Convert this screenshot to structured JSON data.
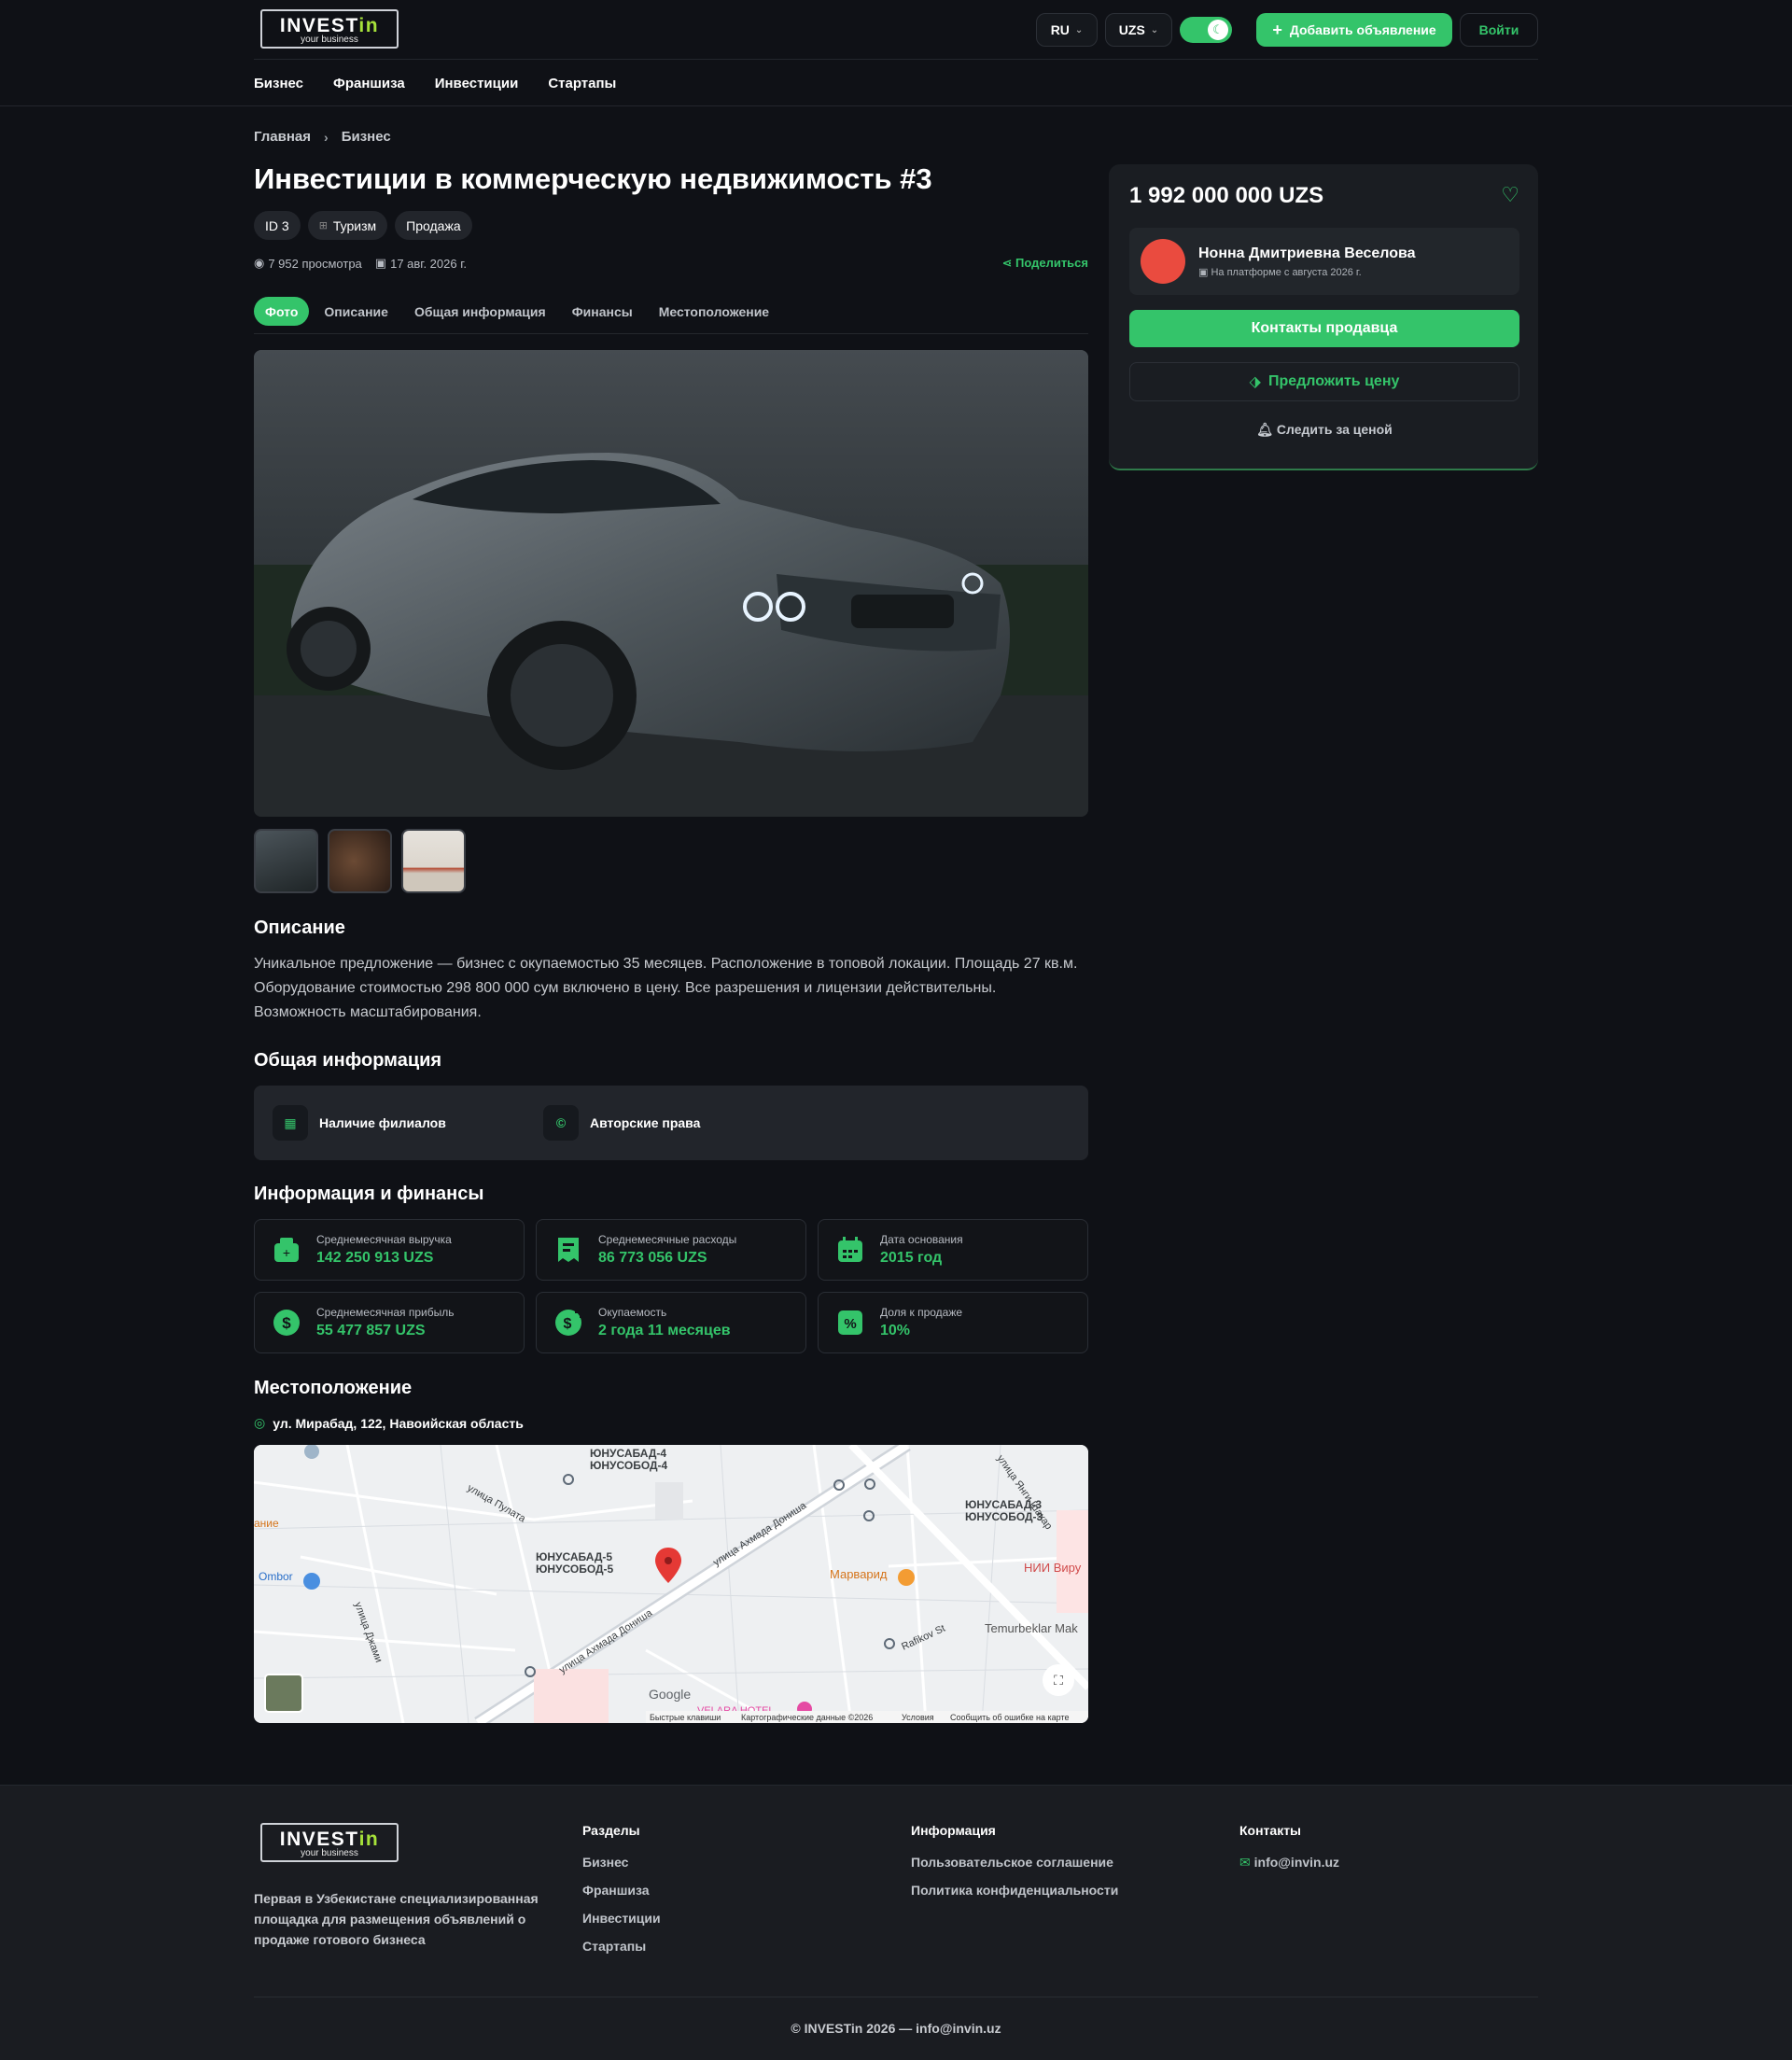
{
  "header": {
    "logo_word": "INVEST",
    "logo_accent": "in",
    "logo_tagline": "your business",
    "lang": "RU",
    "currency": "UZS",
    "add_label": "Добавить объявление",
    "login_label": "Войти",
    "accent_color": "#34c46a"
  },
  "nav": [
    "Бизнес",
    "Франшиза",
    "Инвестиции",
    "Стартапы"
  ],
  "breadcrumb": [
    "Главная",
    "Бизнес"
  ],
  "listing": {
    "title": "Инвестиции в коммерческую недвижимость #3",
    "tags": [
      "ID 3",
      "Туризм",
      "Продажа"
    ],
    "views": "7 952 просмотра",
    "date": "17 авг. 2026 г.",
    "share": "Поделиться"
  },
  "tabs": [
    "Фото",
    "Описание",
    "Общая информация",
    "Финансы",
    "Местоположение"
  ],
  "sections": {
    "description_title": "Описание",
    "description": "Уникальное предложение — бизнес с окупаемостью 35 месяцев. Расположение в топовой локации. Площадь 27 кв.м. Оборудование стоимостью 298 800 000 сум включено в цену. Все разрешения и лицензии действительны. Возможность масштабирования.",
    "general_title": "Общая информация",
    "general": [
      "Наличие филиалов",
      "Авторские права"
    ],
    "finance_title": "Информация и финансы",
    "finance": [
      {
        "label": "Среднемесячная выручка",
        "value": "142 250 913 UZS"
      },
      {
        "label": "Среднемесячные расходы",
        "value": "86 773 056 UZS"
      },
      {
        "label": "Дата основания",
        "value": "2015 год"
      },
      {
        "label": "Среднемесячная прибыль",
        "value": "55 477 857 UZS"
      },
      {
        "label": "Окупаемость",
        "value": "2 года 11 месяцев"
      },
      {
        "label": "Доля к продаже",
        "value": "10%"
      }
    ],
    "location_title": "Местоположение",
    "address": "ул. Мирабад, 122, Навоийская область"
  },
  "map": {
    "labels": [
      "ЮНУСАБАД-4",
      "ЮНУСОБОД-4",
      "ЮНУСАБАД-5",
      "ЮНУСОБОД-5",
      "ЮНУСАБАД-3",
      "ЮНУСОБОД-3",
      "улица Ахмада Дониша",
      "улица Ахмада Дониша",
      "Марварид",
      "НИИ Виру",
      "Temurbeklar Mak",
      "Ombor",
      "ание",
      "улица Пулата",
      "улица Джами",
      "Rafikov St",
      "улица Янги Шахар",
      "Google",
      "VELARA HOTEL"
    ],
    "footer_items": [
      "Быстрые клавиши",
      "Картографические данные ©2026",
      "Условия",
      "Сообщить об ошибке на карте"
    ]
  },
  "seller_card": {
    "price": "1 992 000 000 UZS",
    "name": "Нонна Дмитриевна Веселова",
    "since": "На платформе с августа 2026 г.",
    "contacts_label": "Контакты продавца",
    "offer_label": "Предложить цену",
    "watch_label": "Следить за ценой"
  },
  "footer": {
    "description": "Первая в Узбекистане специализированная площадка для размещения объявлений о продаже готового бизнеса",
    "sections_title": "Разделы",
    "sections": [
      "Бизнес",
      "Франшиза",
      "Инвестиции",
      "Стартапы"
    ],
    "info_title": "Информация",
    "info": [
      "Пользовательское соглашение",
      "Политика конфиденциальности"
    ],
    "contacts_title": "Контакты",
    "email": "info@invin.uz",
    "copyright": "© INVESTin 2026 — info@invin.uz"
  }
}
